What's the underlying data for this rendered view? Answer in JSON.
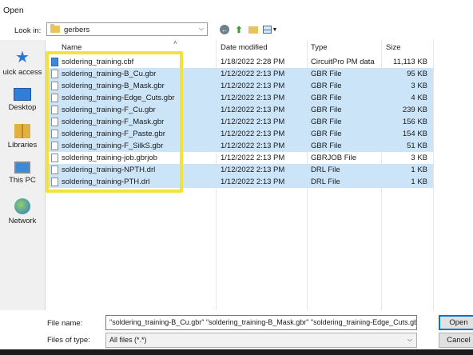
{
  "window": {
    "title": "Open"
  },
  "lookin": {
    "label": "Look in:",
    "value": "gerbers"
  },
  "toolbar": {
    "back_icon": "back-arrow-icon",
    "up_icon": "up-folder-icon",
    "newfolder_icon": "new-folder-icon",
    "views_icon": "views-menu-icon"
  },
  "sidebar": {
    "items": [
      {
        "label": "uick access",
        "icon": "star-icon"
      },
      {
        "label": "Desktop",
        "icon": "desktop-icon"
      },
      {
        "label": "Libraries",
        "icon": "libraries-icon"
      },
      {
        "label": "This PC",
        "icon": "computer-icon"
      },
      {
        "label": "Network",
        "icon": "network-icon"
      }
    ]
  },
  "columns": {
    "name": "Name",
    "date": "Date modified",
    "type": "Type",
    "size": "Size"
  },
  "files": [
    {
      "name": "soldering_training.cbf",
      "date": "1/18/2022 2:28 PM",
      "type": "CircuitPro PM data",
      "size": "11,113 KB",
      "selected": false
    },
    {
      "name": "soldering_training-B_Cu.gbr",
      "date": "1/12/2022 2:13 PM",
      "type": "GBR File",
      "size": "95 KB",
      "selected": true
    },
    {
      "name": "soldering_training-B_Mask.gbr",
      "date": "1/12/2022 2:13 PM",
      "type": "GBR File",
      "size": "3 KB",
      "selected": true
    },
    {
      "name": "soldering_training-Edge_Cuts.gbr",
      "date": "1/12/2022 2:13 PM",
      "type": "GBR File",
      "size": "4 KB",
      "selected": true
    },
    {
      "name": "soldering_training-F_Cu.gbr",
      "date": "1/12/2022 2:13 PM",
      "type": "GBR File",
      "size": "239 KB",
      "selected": true
    },
    {
      "name": "soldering_training-F_Mask.gbr",
      "date": "1/12/2022 2:13 PM",
      "type": "GBR File",
      "size": "156 KB",
      "selected": true
    },
    {
      "name": "soldering_training-F_Paste.gbr",
      "date": "1/12/2022 2:13 PM",
      "type": "GBR File",
      "size": "154 KB",
      "selected": true
    },
    {
      "name": "soldering_training-F_SilkS.gbr",
      "date": "1/12/2022 2:13 PM",
      "type": "GBR File",
      "size": "51 KB",
      "selected": true
    },
    {
      "name": "soldering_training-job.gbrjob",
      "date": "1/12/2022 2:13 PM",
      "type": "GBRJOB File",
      "size": "3 KB",
      "selected": false
    },
    {
      "name": "soldering_training-NPTH.drl",
      "date": "1/12/2022 2:13 PM",
      "type": "DRL File",
      "size": "1 KB",
      "selected": true
    },
    {
      "name": "soldering_training-PTH.drl",
      "date": "1/12/2022 2:13 PM",
      "type": "DRL File",
      "size": "1 KB",
      "selected": true
    }
  ],
  "filename": {
    "label": "File name:",
    "value": "\"soldering_training-B_Cu.gbr\" \"soldering_training-B_Mask.gbr\" \"soldering_training-Edge_Cuts.gbr\" \"s"
  },
  "filetype": {
    "label": "Files of type:",
    "value": "All files (*.*)"
  },
  "buttons": {
    "open": "Open",
    "cancel": "Cancel"
  },
  "colors": {
    "selection": "#cce4f7",
    "highlight_box": "#f2e23a",
    "accent": "#0078d7"
  }
}
